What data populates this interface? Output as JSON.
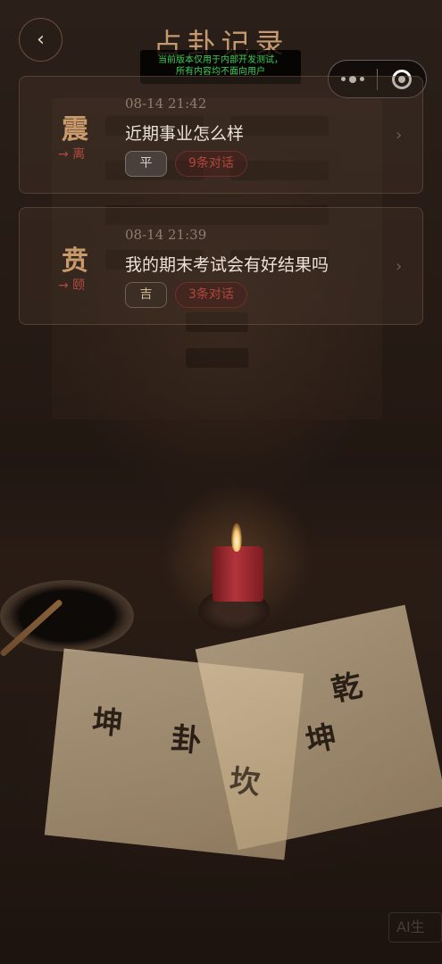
{
  "header": {
    "title": "占卦记录",
    "back_label": "‹",
    "dev_notice_line1": "当前版本仅用于内部开发测试，",
    "dev_notice_line2": "所有内容均不面向用户"
  },
  "capsule": {
    "more_icon": "more-dots-icon",
    "close_icon": "target-circle-icon"
  },
  "records": [
    {
      "hexagram": "震",
      "changed_to": "→ 离",
      "time": "08-14 21:42",
      "question": "近期事业怎么样",
      "fortune": "平",
      "chat_count": "9条对话"
    },
    {
      "hexagram": "贲",
      "changed_to": "→ 颐",
      "time": "08-14 21:39",
      "question": "我的期末考试会有好结果吗",
      "fortune": "吉",
      "chat_count": "3条对话"
    }
  ],
  "background": {
    "paper_chars": [
      "乾",
      "坤",
      "卦",
      "坤",
      "坎"
    ]
  },
  "watermark": {
    "text": "AI生"
  },
  "colors": {
    "title": "#c59a70",
    "hexagram": "#c99b6c",
    "accent_red": "#b04a3f",
    "dev_notice": "#3fcf57"
  }
}
